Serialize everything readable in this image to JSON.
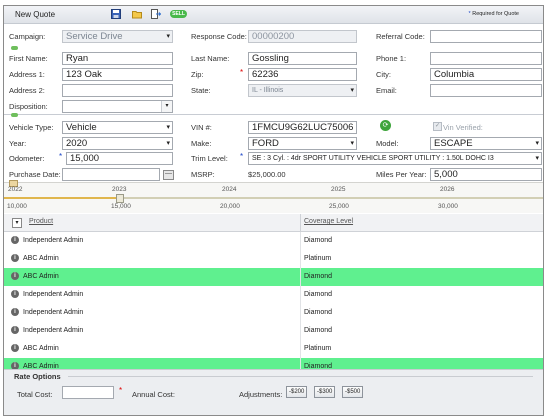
{
  "header": {
    "title": "New Quote",
    "sell_label": "SELL",
    "required_note": "Required for Quote",
    "required_star": "*"
  },
  "customer": {
    "campaign_label": "Campaign:",
    "campaign_value": "Service Drive",
    "response_code_label": "Response Code:",
    "response_code_value": "00000200",
    "referral_code_label": "Referral Code:",
    "referral_code_value": "",
    "first_name_label": "First Name:",
    "first_name_value": "Ryan",
    "last_name_label": "Last Name:",
    "last_name_value": "Gossling",
    "phone1_label": "Phone 1:",
    "phone1_value": "",
    "address1_label": "Address 1:",
    "address1_value": "123 Oak",
    "zip_label": "Zip:",
    "zip_value": "62236",
    "city_label": "City:",
    "city_value": "Columbia",
    "address2_label": "Address 2:",
    "address2_value": "",
    "state_label": "State:",
    "state_value": "IL - Illinois",
    "email_label": "Email:",
    "email_value": "",
    "disposition_label": "Disposition:",
    "disposition_value": ""
  },
  "vehicle": {
    "type_label": "Vehicle Type:",
    "type_value": "Vehicle",
    "vin_label": "VIN #:",
    "vin_value": "1FMCU9G62LUC75006",
    "vin_verified_label": "Vin Verified:",
    "year_label": "Year:",
    "year_value": "2020",
    "make_label": "Make:",
    "make_value": "FORD",
    "model_label": "Model:",
    "model_value": "ESCAPE",
    "odometer_label": "Odometer:",
    "odometer_value": "15,000",
    "trim_label": "Trim Level:",
    "trim_value": "SE : 3 Cyl. : 4dr SPORT UTILITY VEHICLE SPORT UTILITY : 1.50L DOHC I3",
    "purchase_date_label": "Purchase Date:",
    "purchase_date_value": "",
    "msrp_label": "MSRP:",
    "msrp_value": "$25,000.00",
    "miles_per_year_label": "Miles Per Year:",
    "miles_per_year_value": "5,000"
  },
  "slider": {
    "years": [
      "2022",
      "2023",
      "2024",
      "2025",
      "2026"
    ],
    "miles": [
      "10,000",
      "15,000",
      "20,000",
      "25,000",
      "30,000"
    ],
    "value": "15,000"
  },
  "grid": {
    "headers": {
      "product": "Product",
      "coverage": "Coverage Level"
    },
    "rows": [
      {
        "product": "Independent Admin",
        "coverage": "Diamond",
        "highlight": false
      },
      {
        "product": "ABC Admin",
        "coverage": "Platinum",
        "highlight": false
      },
      {
        "product": "ABC Admin",
        "coverage": "Diamond",
        "highlight": true
      },
      {
        "product": "Independent Admin",
        "coverage": "Diamond",
        "highlight": false
      },
      {
        "product": "Independent Admin",
        "coverage": "Diamond",
        "highlight": false
      },
      {
        "product": "Independent Admin",
        "coverage": "Diamond",
        "highlight": false
      },
      {
        "product": "ABC Admin",
        "coverage": "Platinum",
        "highlight": false
      },
      {
        "product": "ABC Admin",
        "coverage": "Diamond",
        "highlight": true
      }
    ]
  },
  "rate_options": {
    "title": "Rate Options",
    "total_cost_label": "Total Cost:",
    "total_cost_value": "",
    "annual_cost_label": "Annual Cost:",
    "adjustments_label": "Adjustments:",
    "adjustments": [
      "-$200",
      "-$300",
      "-$500"
    ]
  },
  "colors": {
    "highlight_row": "#5ff08f",
    "required_star": "#dd0000",
    "accent_green": "#48b94a"
  },
  "icons": [
    "save-icon",
    "folder-icon",
    "export-icon",
    "sell-icon",
    "info-icon",
    "filter-icon",
    "calendar-icon",
    "vin-decode-icon"
  ]
}
